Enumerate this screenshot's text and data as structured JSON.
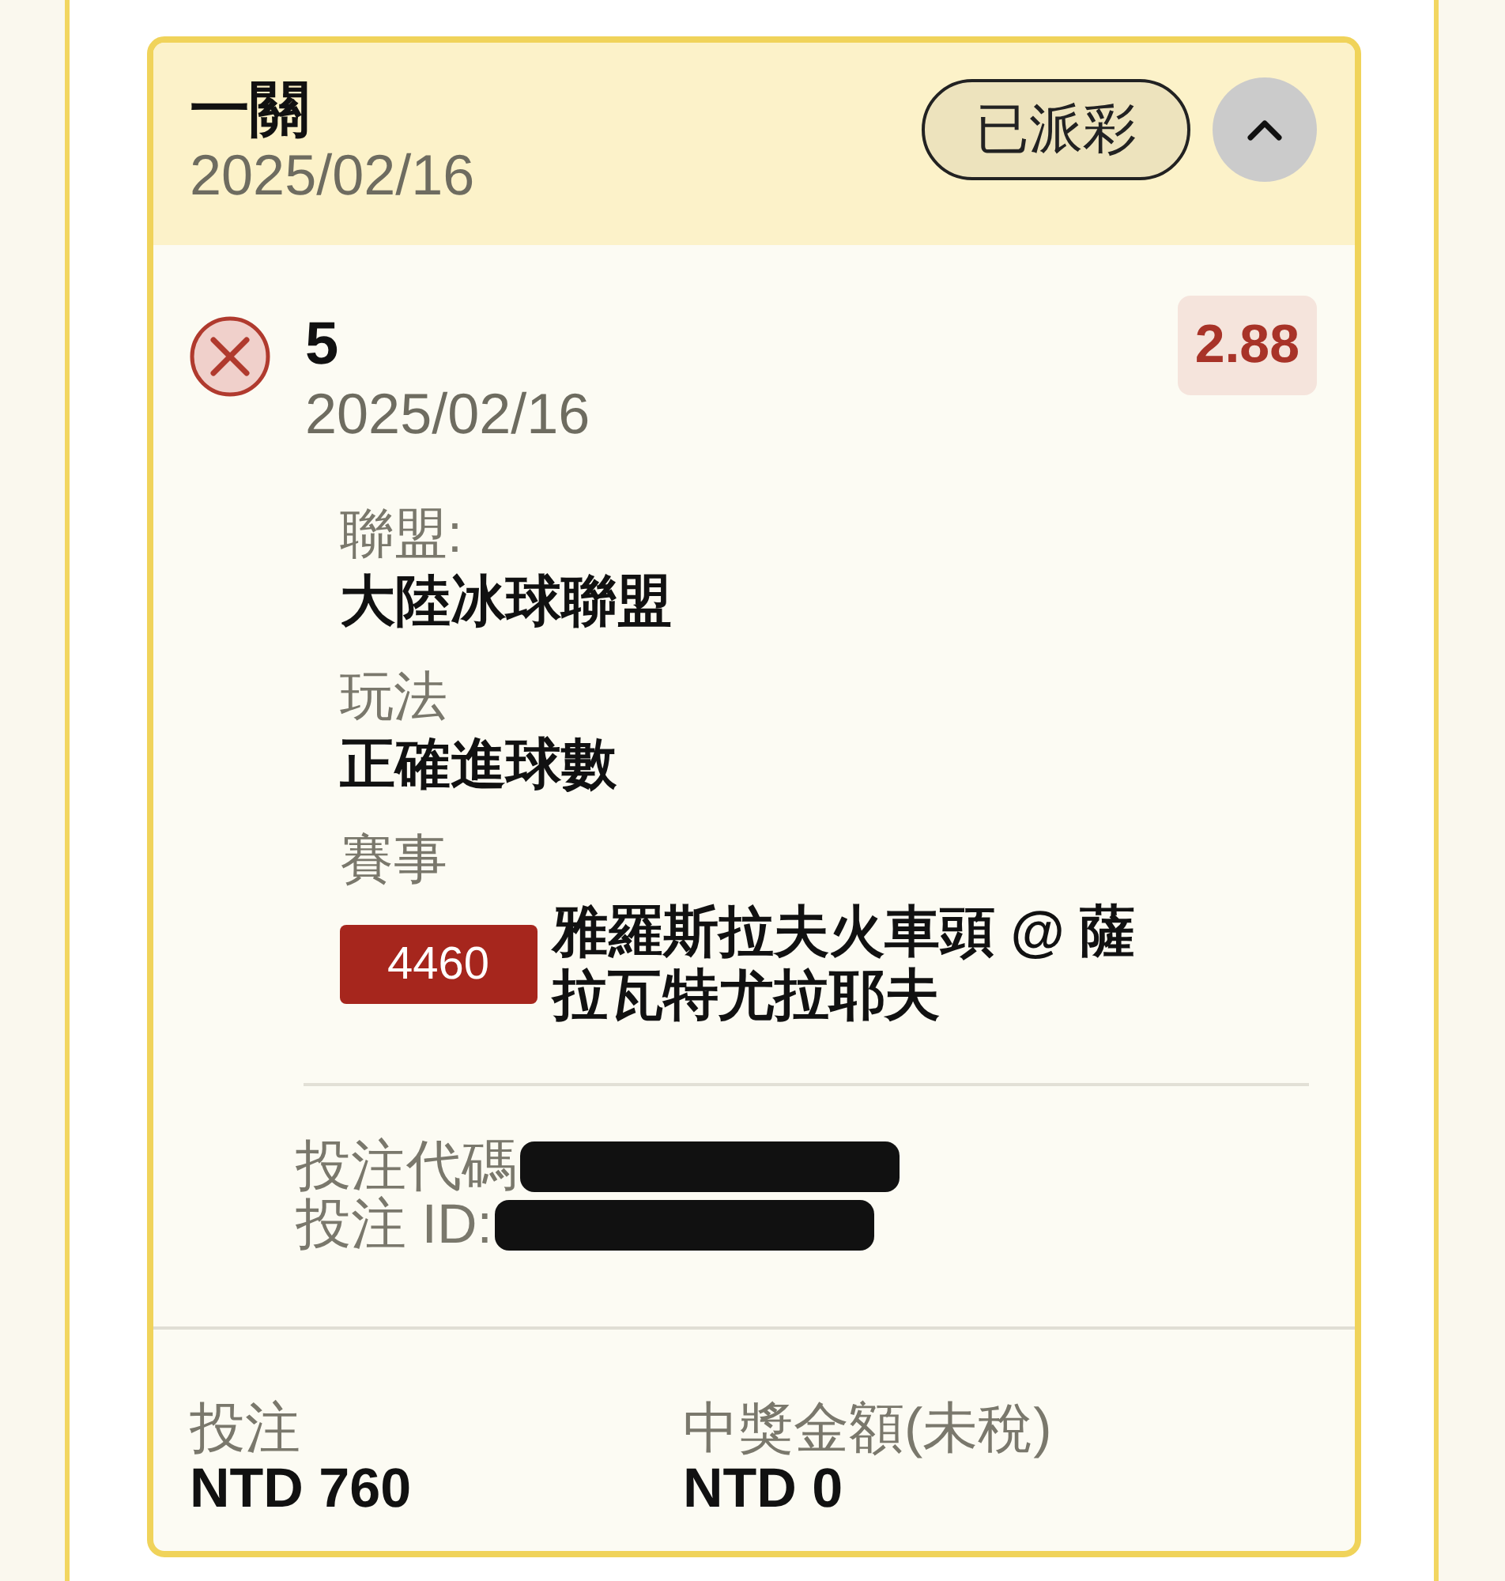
{
  "ticket": {
    "title": "一關",
    "date": "2025/02/16",
    "status_badge": "已派彩",
    "expanded": true
  },
  "selection": {
    "lost": true,
    "pick": "5",
    "date": "2025/02/16",
    "odds": "2.88",
    "details": [
      {
        "kind": "text",
        "label": "聯盟:",
        "value": "大陸冰球聯盟"
      },
      {
        "kind": "text",
        "label": "玩法",
        "value": "正確進球數"
      },
      {
        "kind": "event",
        "label": "賽事",
        "event_code": "4460",
        "value": "雅羅斯拉夫火車頭 @ 薩拉瓦特尤拉耶夫"
      }
    ]
  },
  "references": [
    {
      "label": "投注代碼",
      "redacted": true
    },
    {
      "label": "投注 ID:",
      "redacted": true
    }
  ],
  "totals": [
    {
      "label": "投注",
      "value": "NTD 760"
    },
    {
      "label": "中獎金額(未稅)",
      "value": "NTD 0"
    }
  ]
}
